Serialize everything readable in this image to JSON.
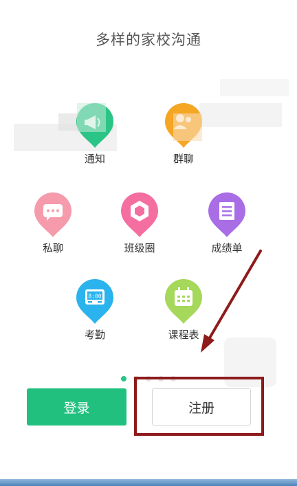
{
  "title": "多样的家校沟通",
  "features": [
    {
      "label": "通知",
      "icon": "megaphone-icon",
      "color": "#2bc487"
    },
    {
      "label": "群聊",
      "icon": "group-chat-icon",
      "color": "#f5a623"
    },
    {
      "label": "私聊",
      "icon": "private-chat-icon",
      "color": "#f59bab"
    },
    {
      "label": "班级圈",
      "icon": "class-circle-icon",
      "color": "#f46fa0"
    },
    {
      "label": "成绩单",
      "icon": "transcript-icon",
      "color": "#a96ee6"
    },
    {
      "label": "考勤",
      "icon": "attendance-clock-icon",
      "color": "#2ab3ec",
      "display_text": "8:00"
    },
    {
      "label": "课程表",
      "icon": "calendar-icon",
      "color": "#a5d85b"
    }
  ],
  "pagination": {
    "total": 5,
    "active": 1
  },
  "buttons": {
    "login": "登录",
    "register": "注册"
  },
  "annotation": {
    "color": "#8e1b1b"
  },
  "colors": {
    "brand_green": "#22c07f",
    "title_gray": "#555555"
  }
}
